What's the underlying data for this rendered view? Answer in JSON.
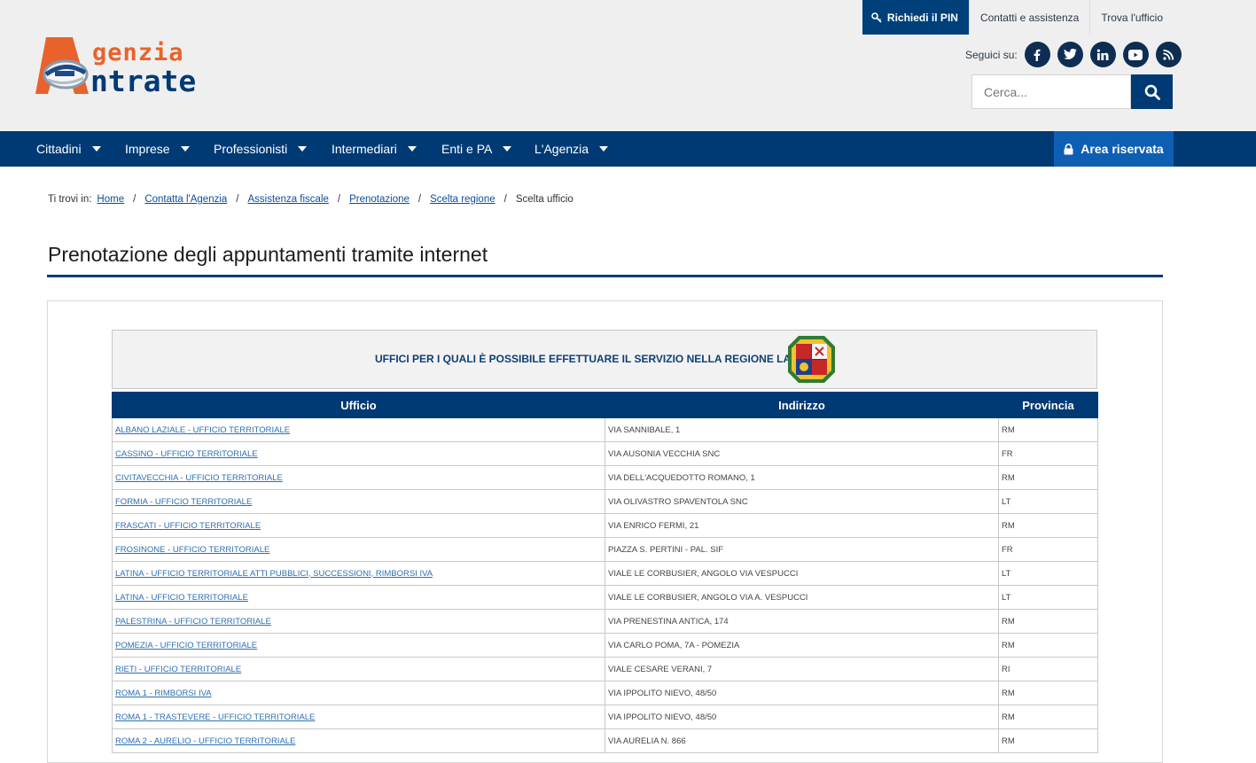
{
  "header": {
    "logo_line1": "genzia",
    "logo_line2": "ntrate",
    "top_links": {
      "pin": "Richiedi il PIN",
      "contatti": "Contatti e assistenza",
      "trova": "Trova l'ufficio"
    },
    "social_label": "Seguici su:",
    "search_placeholder": "Cerca..."
  },
  "nav": {
    "items": [
      "Cittadini",
      "Imprese",
      "Professionisti",
      "Intermediari",
      "Enti e PA",
      "L'Agenzia"
    ],
    "area_riservata": "Area riservata"
  },
  "breadcrumb": {
    "prefix": "Ti trovi in:",
    "items": [
      "Home",
      "Contatta l'Agenzia",
      "Assistenza fiscale",
      "Prenotazione",
      "Scelta regione"
    ],
    "current": "Scelta ufficio"
  },
  "page_title": "Prenotazione degli appuntamenti tramite internet",
  "banner_text": "UFFICI PER I QUALI È POSSIBILE EFFETTUARE IL SERVIZIO  NELLA REGIONE LAZIO",
  "table": {
    "headers": {
      "ufficio": "Ufficio",
      "indirizzo": "Indirizzo",
      "provincia": "Provincia"
    },
    "rows": [
      {
        "ufficio": "ALBANO LAZIALE - UFFICIO TERRITORIALE",
        "indirizzo": "VIA SANNIBALE, 1",
        "provincia": "RM"
      },
      {
        "ufficio": "CASSINO - UFFICIO TERRITORIALE",
        "indirizzo": "VIA AUSONIA VECCHIA SNC",
        "provincia": "FR"
      },
      {
        "ufficio": "CIVITAVECCHIA - UFFICIO TERRITORIALE",
        "indirizzo": "VIA DELL'ACQUEDOTTO ROMANO, 1",
        "provincia": "RM"
      },
      {
        "ufficio": "FORMIA - UFFICIO TERRITORIALE",
        "indirizzo": "VIA OLIVASTRO SPAVENTOLA SNC",
        "provincia": "LT"
      },
      {
        "ufficio": "FRASCATI - UFFICIO TERRITORIALE",
        "indirizzo": "VIA ENRICO FERMI, 21",
        "provincia": "RM"
      },
      {
        "ufficio": "FROSINONE - UFFICIO TERRITORIALE",
        "indirizzo": "PIAZZA S. PERTINI - PAL. SIF",
        "provincia": "FR"
      },
      {
        "ufficio": "LATINA - UFFICIO TERRITORIALE ATTI PUBBLICI, SUCCESSIONI, RIMBORSI IVA",
        "indirizzo": "VIALE LE CORBUSIER, ANGOLO VIA VESPUCCI",
        "provincia": "LT"
      },
      {
        "ufficio": "LATINA - UFFICIO TERRITORIALE",
        "indirizzo": "VIALE LE CORBUSIER, ANGOLO VIA A. VESPUCCI",
        "provincia": "LT"
      },
      {
        "ufficio": "PALESTRINA - UFFICIO TERRITORIALE",
        "indirizzo": "VIA PRENESTINA ANTICA, 174",
        "provincia": "RM"
      },
      {
        "ufficio": "POMEZIA - UFFICIO TERRITORIALE",
        "indirizzo": "VIA CARLO POMA, 7A - POMEZIA",
        "provincia": "RM"
      },
      {
        "ufficio": "RIETI - UFFICIO TERRITORIALE",
        "indirizzo": "VIALE CESARE VERANI, 7",
        "provincia": "RI"
      },
      {
        "ufficio": "ROMA 1 - RIMBORSI IVA",
        "indirizzo": "VIA IPPOLITO NIEVO, 48/50",
        "provincia": "RM"
      },
      {
        "ufficio": "ROMA 1 - TRASTEVERE - UFFICIO TERRITORIALE",
        "indirizzo": "VIA IPPOLITO NIEVO, 48/50",
        "provincia": "RM"
      },
      {
        "ufficio": "ROMA 2 - AURELIO - UFFICIO TERRITORIALE",
        "indirizzo": "VIA AURELIA N. 866",
        "provincia": "RM"
      }
    ]
  }
}
